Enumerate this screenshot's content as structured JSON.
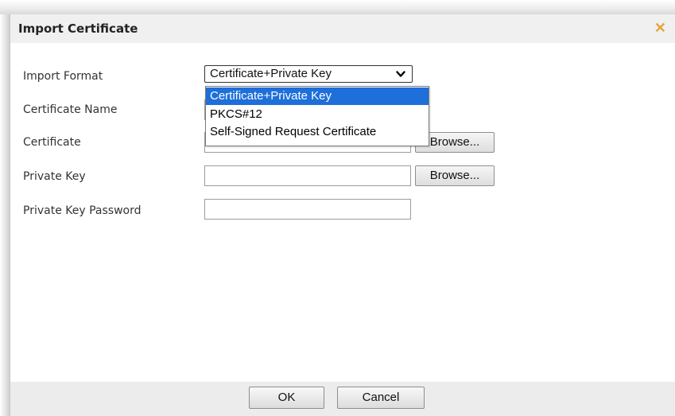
{
  "dialog": {
    "title": "Import Certificate",
    "close_glyph": "✕"
  },
  "form": {
    "import_format": {
      "label": "Import Format",
      "value": "Certificate+Private Key",
      "options": [
        "Certificate+Private Key",
        "PKCS#12",
        "Self-Signed Request Certificate"
      ]
    },
    "certificate_name": {
      "label": "Certificate Name",
      "value": ""
    },
    "certificate": {
      "label": "Certificate",
      "value": "",
      "browse_label": "Browse..."
    },
    "private_key": {
      "label": "Private Key",
      "value": "",
      "browse_label": "Browse..."
    },
    "private_key_password": {
      "label": "Private Key Password",
      "value": ""
    }
  },
  "footer": {
    "ok_label": "OK",
    "cancel_label": "Cancel"
  },
  "colors": {
    "accent": "#1e6fd9",
    "close_icon": "#e8a33c"
  }
}
